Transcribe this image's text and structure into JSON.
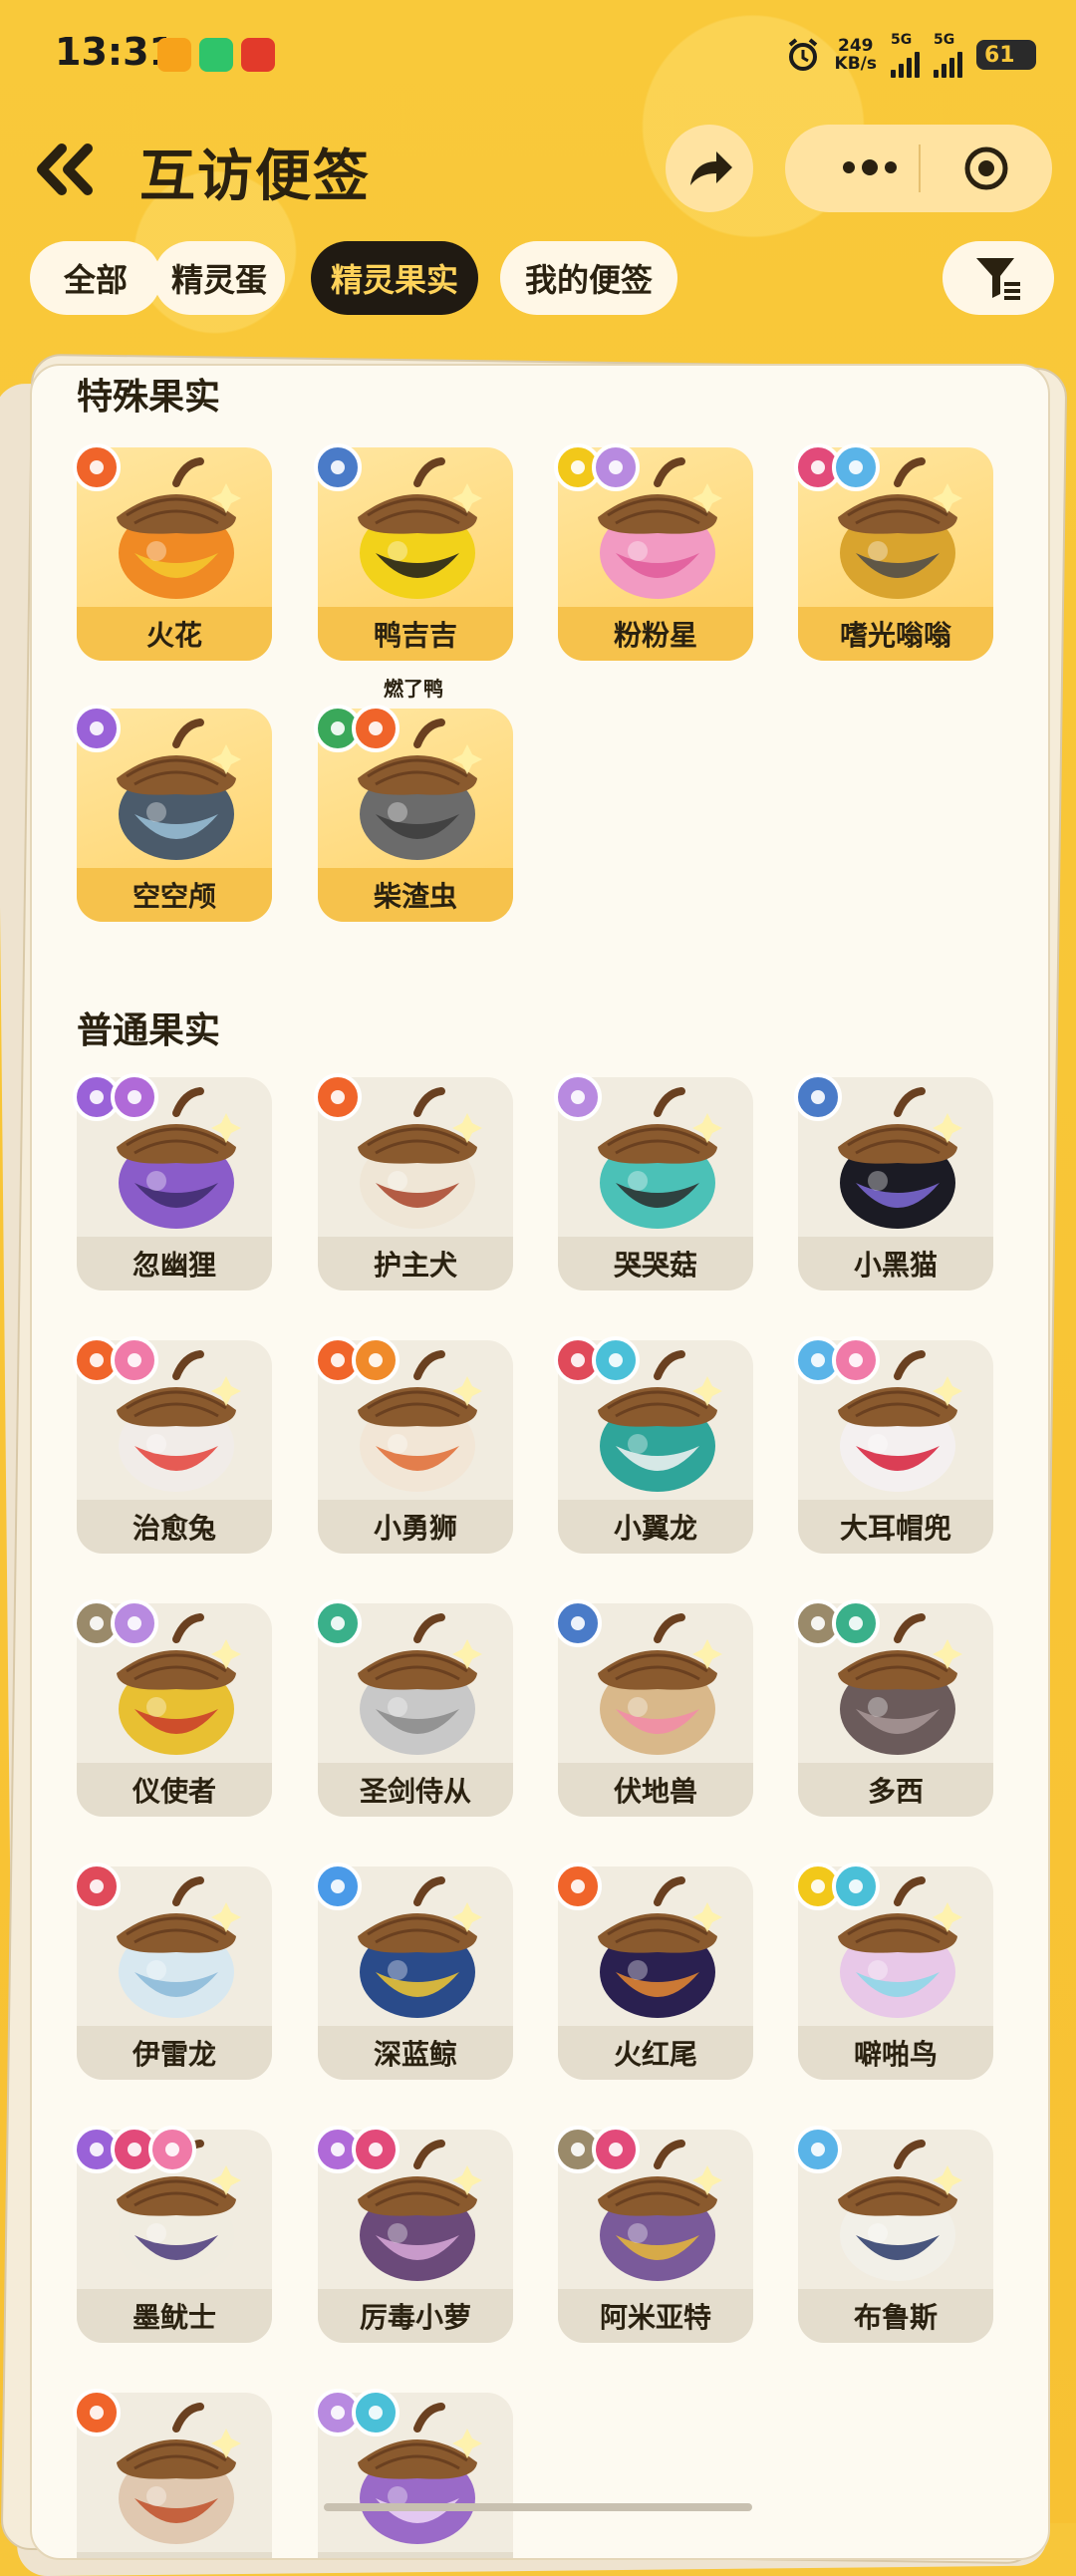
{
  "status_bar": {
    "time": "13:31",
    "speed_value": "249",
    "speed_unit": "KB/s",
    "net1": "5G",
    "net2": "5G",
    "battery": "61"
  },
  "header": {
    "title": "互访便签",
    "back_icon": "double-chevron-left-icon",
    "share_icon": "share-arrow-icon",
    "more_icon": "more-dots-icon",
    "close_icon": "target-circle-icon"
  },
  "tabs": [
    {
      "label": "全部",
      "active": false
    },
    {
      "label": "精灵蛋",
      "active": false
    },
    {
      "label": "精灵果实",
      "active": true
    },
    {
      "label": "我的便签",
      "active": false
    }
  ],
  "filter_icon": "funnel-filter-icon",
  "special": {
    "title": "特殊果实",
    "items": [
      {
        "name": "火花",
        "badges": [
          "fire"
        ],
        "shell": "#f08a24",
        "shell2": "#f5c92e"
      },
      {
        "name": "鸭吉吉",
        "badges": [
          "normal"
        ],
        "shell": "#f2d21a",
        "shell2": "#1b1b1b",
        "note": "燃了鸭"
      },
      {
        "name": "粉粉星",
        "badges": [
          "electric",
          "psychic"
        ],
        "shell": "#f29ac2",
        "shell2": "#e05a9a"
      },
      {
        "name": "嗜光嗡嗡",
        "badges": [
          "demon",
          "ice"
        ],
        "shell": "#d9a42e",
        "shell2": "#4a4a4a"
      },
      {
        "name": "空空颅",
        "badges": [
          "ghost"
        ],
        "shell": "#4b5b6b",
        "shell2": "#9bc2d8"
      },
      {
        "name": "柴渣虫",
        "badges": [
          "grass",
          "fire"
        ],
        "shell": "#6b6b6b",
        "shell2": "#3b3b3b"
      }
    ]
  },
  "normal": {
    "title": "普通果实",
    "items": [
      {
        "name": "忽幽狸",
        "badges": [
          "ghost",
          "poison"
        ],
        "shell": "#8a5cc9",
        "shell2": "#3c2a6b"
      },
      {
        "name": "护主犬",
        "badges": [
          "fire"
        ],
        "shell": "#efe6d6",
        "shell2": "#a8432a"
      },
      {
        "name": "哭哭菇",
        "badges": [
          "psychic"
        ],
        "shell": "#4bc1b7",
        "shell2": "#2a2a2a"
      },
      {
        "name": "小黑猫",
        "badges": [
          "normal"
        ],
        "shell": "#1b1b24",
        "shell2": "#7f6bd9"
      },
      {
        "name": "治愈兔",
        "badges": [
          "fire",
          "fairy"
        ],
        "shell": "#f1ece8",
        "shell2": "#e4423a"
      },
      {
        "name": "小勇狮",
        "badges": [
          "fire",
          "fight"
        ],
        "shell": "#f2e6d6",
        "shell2": "#e06b34"
      },
      {
        "name": "小翼龙",
        "badges": [
          "dragon",
          "wing"
        ],
        "shell": "#2fa59a",
        "shell2": "#f3f3f3"
      },
      {
        "name": "大耳帽兜",
        "badges": [
          "ice",
          "fairy"
        ],
        "shell": "#f4f0f0",
        "shell2": "#d61f3a"
      },
      {
        "name": "仪使者",
        "badges": [
          "ground",
          "psychic"
        ],
        "shell": "#e8c032",
        "shell2": "#c93a2a"
      },
      {
        "name": "圣剑侍从",
        "badges": [
          "mech"
        ],
        "shell": "#c8c8c8",
        "shell2": "#8a8a8a"
      },
      {
        "name": "伏地兽",
        "badges": [
          "normal"
        ],
        "shell": "#d9b88a",
        "shell2": "#f28aa8"
      },
      {
        "name": "多西",
        "badges": [
          "ground",
          "mech"
        ],
        "shell": "#6b5b5b",
        "shell2": "#a89898"
      },
      {
        "name": "伊雷龙",
        "badges": [
          "dragon"
        ],
        "shell": "#d8e8f0",
        "shell2": "#8ab8d8"
      },
      {
        "name": "深蓝鲸",
        "badges": [
          "water"
        ],
        "shell": "#2a4b8a",
        "shell2": "#f2c830"
      },
      {
        "name": "火红尾",
        "badges": [
          "fire"
        ],
        "shell": "#2a2050",
        "shell2": "#e88a30"
      },
      {
        "name": "噼啪鸟",
        "badges": [
          "electric",
          "wing"
        ],
        "shell": "#e8c8e8",
        "shell2": "#8ad8e8"
      },
      {
        "name": "墨鱿士",
        "badges": [
          "ghost",
          "demon",
          "fairy"
        ],
        "shell": "#f0ece0",
        "shell2": "#4a3a7a"
      },
      {
        "name": "厉毒小萝",
        "badges": [
          "poison",
          "demon"
        ],
        "shell": "#6b4a7a",
        "shell2": "#d8a8d8"
      },
      {
        "name": "阿米亚特",
        "badges": [
          "ground",
          "demon"
        ],
        "shell": "#7a5a9a",
        "shell2": "#e8b83a"
      },
      {
        "name": "布鲁斯",
        "badges": [
          "ice"
        ],
        "shell": "#f2f0e8",
        "shell2": "#2a3a6a"
      },
      {
        "name": "",
        "badges": [
          "fire"
        ],
        "shell": "#e0c8b0",
        "shell2": "#c0502a"
      },
      {
        "name": "",
        "badges": [
          "psychic",
          "wing"
        ],
        "shell": "#9a6ac8",
        "shell2": "#f0d8f8"
      }
    ]
  },
  "badge_colors": {
    "fire": "#f0642a",
    "normal": "#4a7bc8",
    "electric": "#f2c81a",
    "psychic": "#b88ae0",
    "demon": "#e24a7a",
    "ice": "#5ab4e8",
    "ghost": "#9a62d8",
    "grass": "#3aa85a",
    "poison": "#b06ad8",
    "fairy": "#f07aa8",
    "dragon": "#e04a5a",
    "wing": "#4ac0d8",
    "fight": "#f08a2a",
    "ground": "#9a8a6a",
    "mech": "#3ab08a",
    "water": "#4a9ae8"
  },
  "badge_icons": {
    "fire": "fire-icon",
    "normal": "star-icon",
    "electric": "bolt-icon",
    "psychic": "swirl-icon",
    "demon": "demon-icon",
    "ice": "snowflake-icon",
    "ghost": "ghost-icon",
    "grass": "leaf-icon",
    "poison": "poison-icon",
    "fairy": "heart-icon",
    "dragon": "dragon-icon",
    "wing": "wing-icon",
    "fight": "fist-icon",
    "ground": "mountain-icon",
    "mech": "gear-icon",
    "water": "drop-icon"
  }
}
